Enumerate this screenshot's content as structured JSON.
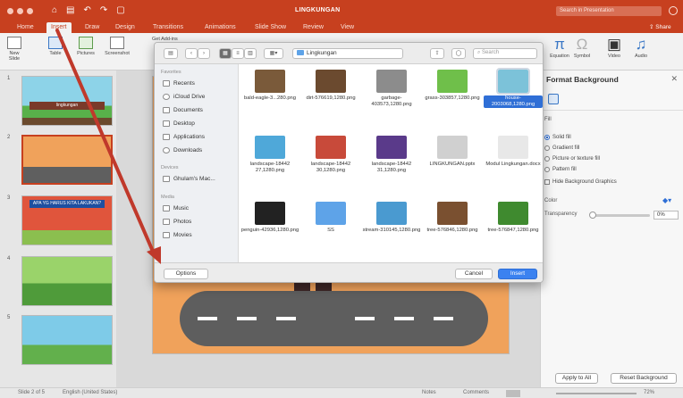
{
  "titlebar": {
    "doc_title": "LINGKUNGAN",
    "search_placeholder": "Search in Presentation"
  },
  "tabs": [
    "Home",
    "Insert",
    "Draw",
    "Design",
    "Transitions",
    "Animations",
    "Slide Show",
    "Review",
    "View"
  ],
  "share_label": "Share",
  "ribbon": {
    "new_slide": "New Slide",
    "table": "Table",
    "pictures": "Pictures",
    "screenshot": "Screenshot",
    "get_addins": "Get Add-ins",
    "equation": "Equation",
    "symbol": "Symbol",
    "video": "Video",
    "audio": "Audio"
  },
  "slides": {
    "numbers": [
      "1",
      "2",
      "3",
      "4",
      "5"
    ],
    "slide1_band": "lingkungan",
    "slide3_band": "APA YG HARUS KITA LAKUKAN?"
  },
  "dialog": {
    "location": "Lingkungan",
    "search_placeholder": "Search",
    "sidebar": {
      "favorites_heading": "Favorites",
      "favorites": [
        "Recents",
        "iCloud Drive",
        "Documents",
        "Desktop",
        "Applications",
        "Downloads"
      ],
      "devices_heading": "Devices",
      "devices": [
        "Ghulam's Mac..."
      ],
      "media_heading": "Media",
      "media": [
        "Music",
        "Photos",
        "Movies"
      ]
    },
    "files": [
      {
        "name": "bald-eagle-3...280.png",
        "color": "#7a5a3a"
      },
      {
        "name": "dirt-576619,1280.png",
        "color": "#6b4a2f"
      },
      {
        "name": "garbage-403573,1280.png",
        "color": "#8c8c8c"
      },
      {
        "name": "grass-303857,1280.png",
        "color": "#6fbf4a"
      },
      {
        "name": "house-2003068,1280.png",
        "color": "#7cc2d9"
      },
      {
        "name": "landscape-18442 27,1280.png",
        "color": "#4fa8d9"
      },
      {
        "name": "landscape-18442 30,1280.png",
        "color": "#c84a3a"
      },
      {
        "name": "landscape-18442 31,1280.png",
        "color": "#5a3a8a"
      },
      {
        "name": "LINGKUNGAN.pptx",
        "color": "#d0d0d0"
      },
      {
        "name": "Modul Lingkungan.docx",
        "color": "#e8e8e8"
      },
      {
        "name": "penguin-42936,1280.png",
        "color": "#222222"
      },
      {
        "name": "SS",
        "color": "#5ea3e8"
      },
      {
        "name": "stream-310145,1280.png",
        "color": "#4a9ad0"
      },
      {
        "name": "tree-576846,1280.png",
        "color": "#7a5030"
      },
      {
        "name": "tree-576847,1280.png",
        "color": "#3f8a2f"
      }
    ],
    "options_button": "Options",
    "cancel_button": "Cancel",
    "insert_button": "Insert"
  },
  "format_pane": {
    "title": "Format Background",
    "fill_label": "Fill",
    "options": [
      "Solid fill",
      "Gradient fill",
      "Picture or texture fill",
      "Pattern fill"
    ],
    "hide_graphics": "Hide Background Graphics",
    "color_label": "Color",
    "transparency_label": "Transparency",
    "transparency_value": "0%",
    "apply_all": "Apply to All",
    "reset": "Reset Background"
  },
  "status": {
    "slide_info": "Slide 2 of 5",
    "language": "English (United States)",
    "notes": "Notes",
    "comments": "Comments",
    "zoom": "72%"
  },
  "colors": {
    "accent": "#c7401f",
    "selection": "#2f6fd6",
    "arrow": "#c0392b"
  }
}
